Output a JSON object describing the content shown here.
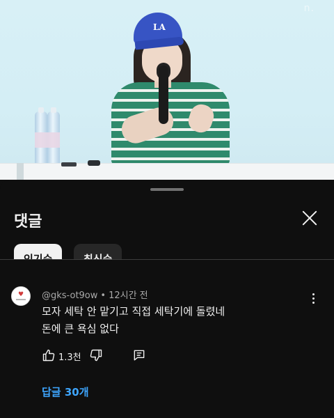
{
  "video": {
    "watermark": "n.",
    "cap_logo": "LA"
  },
  "sheet": {
    "title": "댓글",
    "sort_chips": [
      {
        "label": "인기순",
        "selected": true
      },
      {
        "label": "최신순",
        "selected": false
      }
    ]
  },
  "comment": {
    "author": "@gks-ot9ow",
    "separator": "•",
    "time": "12시간 전",
    "text_lines": [
      "모자 세탁 안 맡기고 직접 세탁기에 돌렸네",
      "돈에 큰 욕심 없다"
    ],
    "like_count": "1.3천",
    "replies_label": "답글 30개"
  },
  "colors": {
    "background": "#0f0f0f",
    "text_primary": "#f1f1f1",
    "text_secondary": "#aaaaaa",
    "link_blue": "#3ea6ff",
    "chip_active_bg": "#f1f1f1",
    "chip_inactive_bg": "#272727"
  },
  "icons": [
    "close-icon",
    "more-vert-icon",
    "thumb-up-icon",
    "thumb-down-icon",
    "reply-icon"
  ]
}
